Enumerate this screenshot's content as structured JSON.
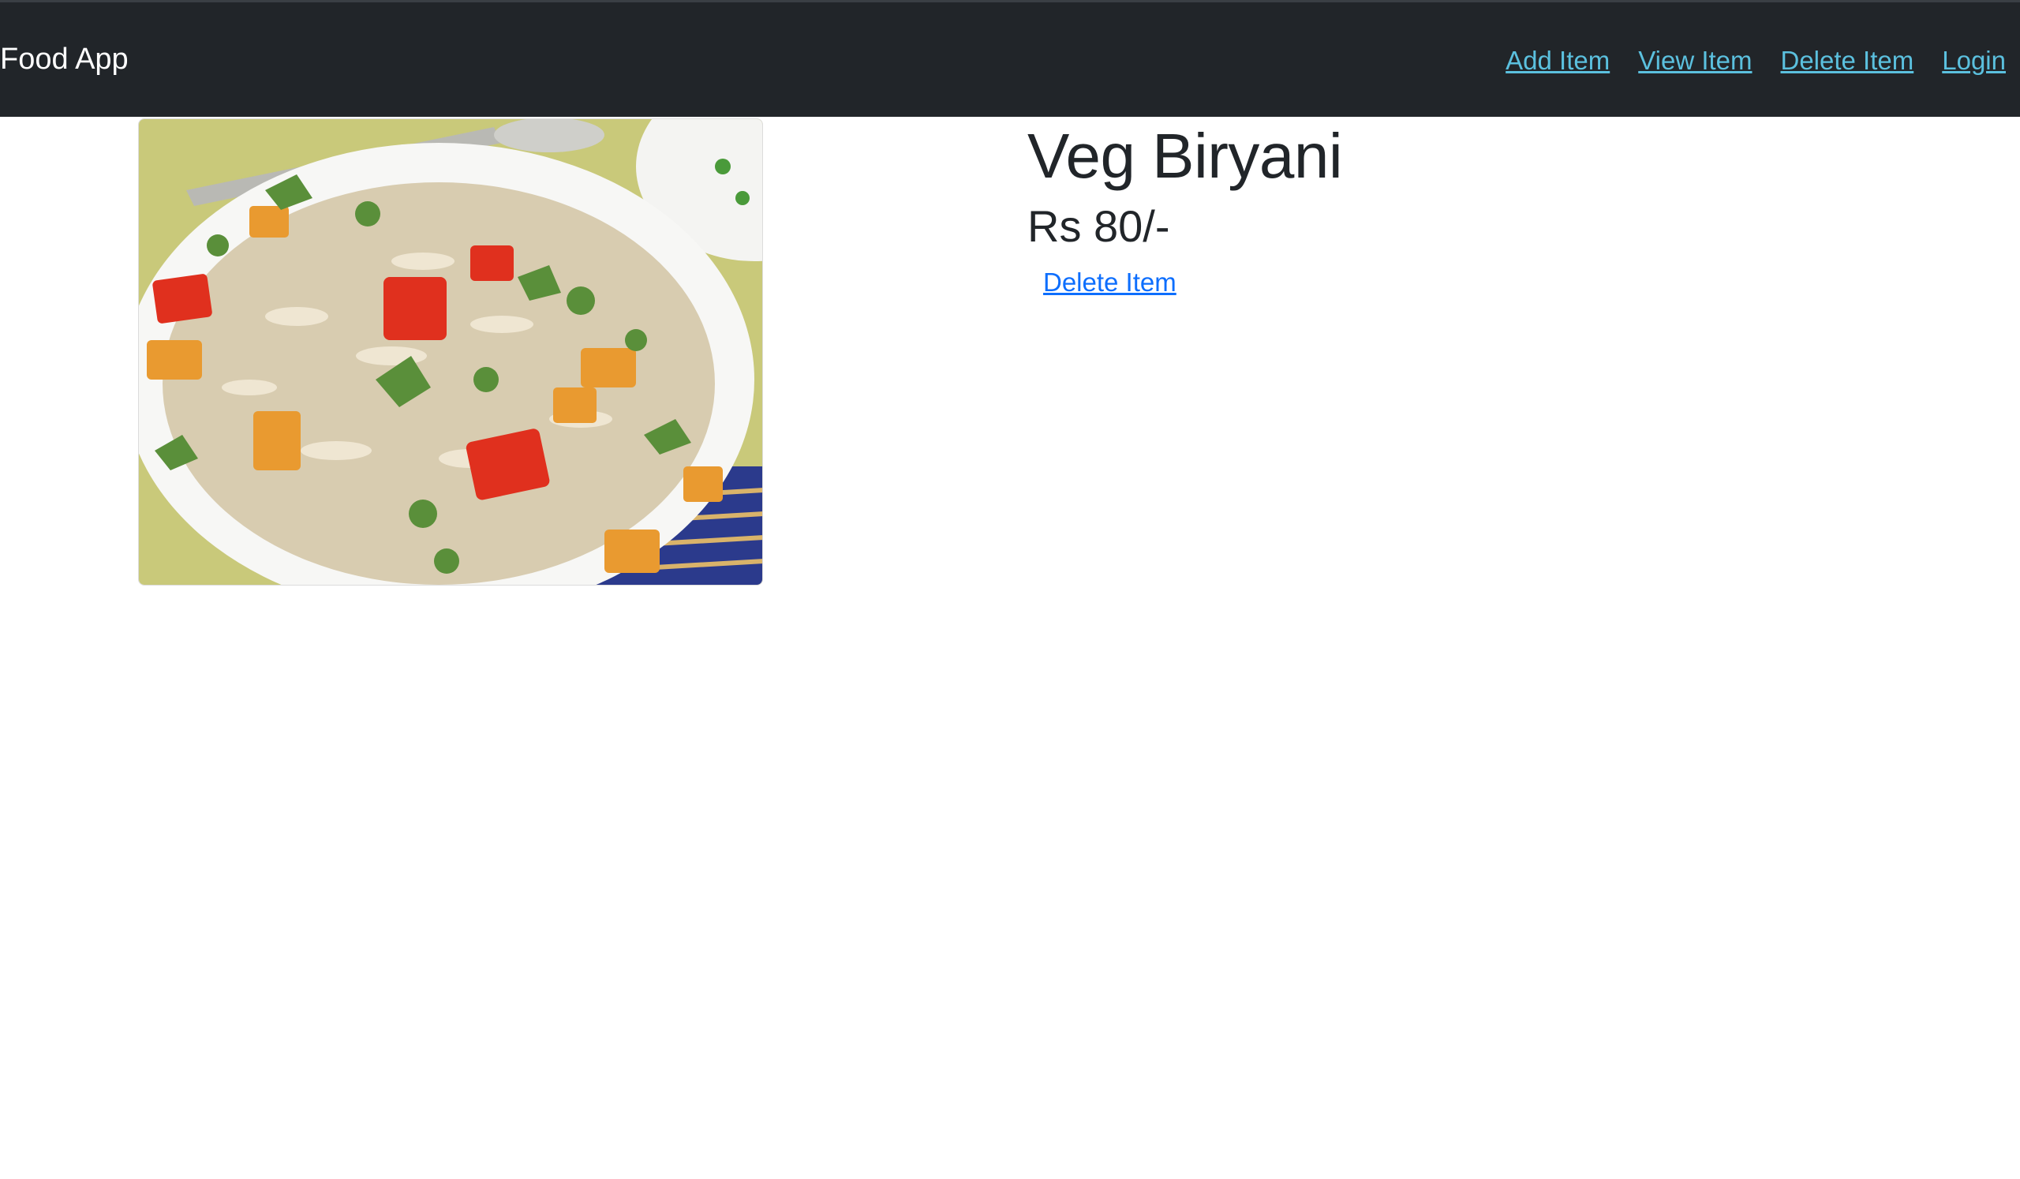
{
  "navbar": {
    "brand": "Food App",
    "links": [
      {
        "label": "Add Item"
      },
      {
        "label": "View Item"
      },
      {
        "label": "Delete Item"
      },
      {
        "label": "Login"
      }
    ]
  },
  "item": {
    "title": "Veg Biryani",
    "price": "Rs 80/-",
    "delete_label": "Delete Item",
    "image_subject": "veg-biryani-photo"
  },
  "colors": {
    "navbar_bg": "#212529",
    "nav_link": "#5bc0de",
    "action_link": "#0d6efd",
    "text": "#212529"
  }
}
